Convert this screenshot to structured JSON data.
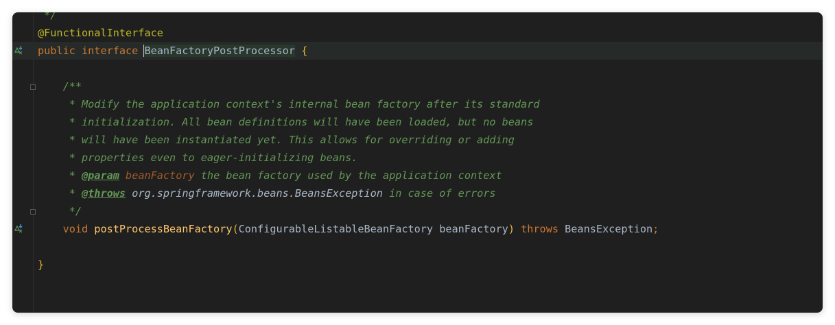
{
  "editor": {
    "language": "java",
    "lines": [
      {
        "id": "l0",
        "parts": [
          {
            "cls": "doc",
            "text": " */"
          }
        ]
      },
      {
        "id": "l1",
        "parts": [
          {
            "cls": "ann",
            "text": "@FunctionalInterface"
          }
        ]
      },
      {
        "id": "l2",
        "gutter_icon": "implemented-icon",
        "parts": [
          {
            "cls": "kw",
            "text": "public "
          },
          {
            "cls": "kw",
            "text": "interface "
          },
          {
            "cls": "hl",
            "text": "BeanFactoryPostProcessor"
          },
          {
            "cls": "",
            "text": " "
          },
          {
            "cls": "brace",
            "text": "{"
          }
        ]
      },
      {
        "id": "l3",
        "parts": []
      },
      {
        "id": "l4",
        "parts": [
          {
            "cls": "doc",
            "text": "    /**"
          }
        ]
      },
      {
        "id": "l5",
        "parts": [
          {
            "cls": "doc",
            "text": "     * Modify the application context's internal bean factory after its standard"
          }
        ]
      },
      {
        "id": "l6",
        "parts": [
          {
            "cls": "doc",
            "text": "     * initialization. All bean definitions will have been loaded, but no beans"
          }
        ]
      },
      {
        "id": "l7",
        "parts": [
          {
            "cls": "doc",
            "text": "     * will have been instantiated yet. This allows for overriding or adding"
          }
        ]
      },
      {
        "id": "l8",
        "parts": [
          {
            "cls": "doc",
            "text": "     * properties even to eager-initializing beans."
          }
        ]
      },
      {
        "id": "l9",
        "parts": [
          {
            "cls": "doc",
            "text": "     * "
          },
          {
            "cls": "doctag",
            "text": "@param"
          },
          {
            "cls": "doc",
            "text": " "
          },
          {
            "cls": "docparam",
            "text": "beanFactory"
          },
          {
            "cls": "doc",
            "text": " the bean factory used by the application context"
          }
        ]
      },
      {
        "id": "l10",
        "parts": [
          {
            "cls": "doc",
            "text": "     * "
          },
          {
            "cls": "doctag",
            "text": "@throws"
          },
          {
            "cls": "doc",
            "text": " "
          },
          {
            "cls": "docref",
            "text": "org.springframework.beans.BeansException"
          },
          {
            "cls": "doc",
            "text": " in case of errors"
          }
        ]
      },
      {
        "id": "l11",
        "parts": [
          {
            "cls": "doc",
            "text": "     */"
          }
        ]
      },
      {
        "id": "l12",
        "gutter_icon": "implemented-icon",
        "parts": [
          {
            "cls": "",
            "text": "    "
          },
          {
            "cls": "kw",
            "text": "void "
          },
          {
            "cls": "fn",
            "text": "postProcessBeanFactory"
          },
          {
            "cls": "brace",
            "text": "("
          },
          {
            "cls": "",
            "text": "ConfigurableListableBeanFactory beanFactory"
          },
          {
            "cls": "brace",
            "text": ")"
          },
          {
            "cls": "",
            "text": " "
          },
          {
            "cls": "kw",
            "text": "throws "
          },
          {
            "cls": "",
            "text": "BeansException"
          },
          {
            "cls": "kw",
            "text": ";"
          }
        ]
      },
      {
        "id": "l13",
        "parts": []
      },
      {
        "id": "l14",
        "parts": [
          {
            "cls": "brace",
            "text": "}"
          }
        ]
      }
    ],
    "active_line": "l2",
    "colors": {
      "background": "#1f1f1f",
      "keyword": "#cc7832",
      "annotation": "#bbb529",
      "method": "#ffc66d",
      "javadoc": "#629755",
      "identifier": "#a9b7c6"
    }
  }
}
